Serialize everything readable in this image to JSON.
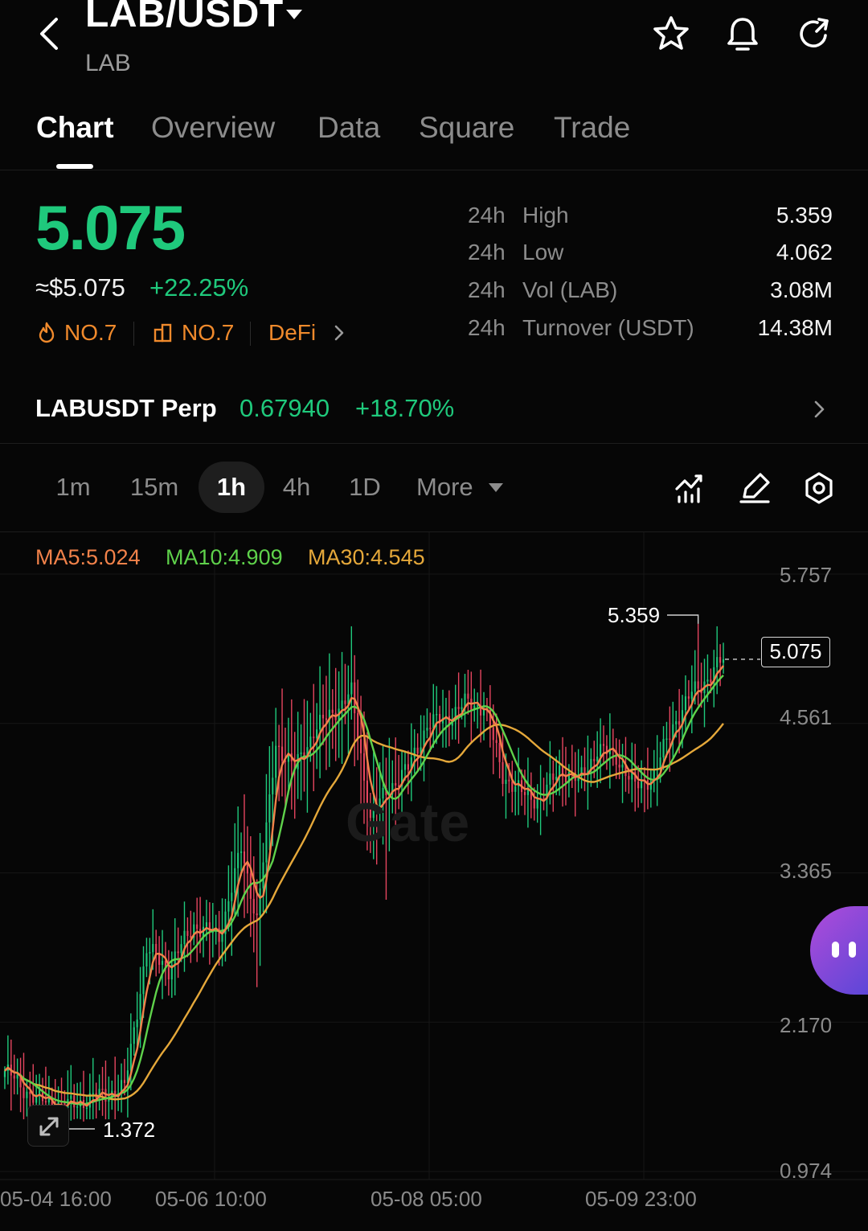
{
  "header": {
    "pair": "LAB/USDT",
    "base": "LAB",
    "icons": [
      "back-chevron-icon",
      "star-icon",
      "bell-icon",
      "refresh-icon"
    ]
  },
  "tabs": [
    {
      "label": "Chart",
      "active": true
    },
    {
      "label": "Overview",
      "active": false
    },
    {
      "label": "Data",
      "active": false
    },
    {
      "label": "Square",
      "active": false
    },
    {
      "label": "Trade",
      "active": false
    }
  ],
  "price": {
    "last": "5.075",
    "usd": "≈$5.075",
    "change": "+22.25%",
    "hot_rank": "NO.7",
    "sector_rank": "NO.7",
    "sector": "DeFi"
  },
  "stats": [
    {
      "prefix": "24h",
      "name": "High",
      "value": "5.359"
    },
    {
      "prefix": "24h",
      "name": "Low",
      "value": "4.062"
    },
    {
      "prefix": "24h",
      "name": "Vol (LAB)",
      "value": "3.08M"
    },
    {
      "prefix": "24h",
      "name": "Turnover (USDT)",
      "value": "14.38M"
    }
  ],
  "perp": {
    "name": "LABUSDT Perp",
    "price": "0.67940",
    "change": "+18.70%"
  },
  "timeframes": {
    "items": [
      "1m",
      "15m",
      "1h",
      "4h",
      "1D"
    ],
    "active": "1h",
    "more_label": "More"
  },
  "colors": {
    "up": "#1fc97c",
    "down": "#e5455f",
    "ma5": "#f2824a",
    "ma10": "#5fd24b",
    "ma30": "#e5a83a",
    "accent_orange": "#f08a2c"
  },
  "chart": {
    "ma_labels": {
      "ma5": "MA5:5.024",
      "ma10": "MA10:4.909",
      "ma30": "MA30:4.545"
    },
    "y_ticks": [
      "5.757",
      "4.561",
      "3.365",
      "2.170",
      "0.974"
    ],
    "x_ticks": [
      "05-04 16:00",
      "05-06 10:00",
      "05-08 05:00",
      "05-09 23:00"
    ],
    "high_marker": "5.359",
    "low_marker": "1.372",
    "last_price": "5.075",
    "watermark": "Gate"
  },
  "chart_data": {
    "type": "candlestick",
    "interval": "1h",
    "ylim": [
      0.974,
      5.757
    ],
    "y_ticks": [
      5.757,
      4.561,
      3.365,
      2.17,
      0.974
    ],
    "x_ticks": [
      "05-04 16:00",
      "05-06 10:00",
      "05-08 05:00",
      "05-09 23:00"
    ],
    "high": 5.359,
    "low": 1.372,
    "last": 5.075,
    "ma": {
      "MA5": 5.024,
      "MA10": 4.909,
      "MA30": 4.545
    },
    "close_anchors": [
      [
        0,
        1.78
      ],
      [
        10,
        1.55
      ],
      [
        20,
        1.5
      ],
      [
        30,
        1.58
      ],
      [
        38,
        1.64
      ],
      [
        45,
        2.75
      ],
      [
        52,
        2.6
      ],
      [
        60,
        2.95
      ],
      [
        68,
        2.85
      ],
      [
        75,
        3.55
      ],
      [
        80,
        3.0
      ],
      [
        86,
        4.4
      ],
      [
        92,
        4.2
      ],
      [
        98,
        4.5
      ],
      [
        104,
        4.65
      ],
      [
        110,
        4.8
      ],
      [
        116,
        3.8
      ],
      [
        122,
        4.05
      ],
      [
        128,
        4.2
      ],
      [
        134,
        4.55
      ],
      [
        140,
        4.6
      ],
      [
        146,
        4.72
      ],
      [
        152,
        4.7
      ],
      [
        158,
        4.15
      ],
      [
        164,
        4.0
      ],
      [
        170,
        3.95
      ],
      [
        176,
        4.2
      ],
      [
        182,
        4.1
      ],
      [
        188,
        4.35
      ],
      [
        194,
        4.3
      ],
      [
        200,
        4.05
      ],
      [
        206,
        4.15
      ],
      [
        212,
        4.55
      ],
      [
        218,
        4.8
      ],
      [
        224,
        4.95
      ],
      [
        228,
        5.08
      ]
    ]
  }
}
